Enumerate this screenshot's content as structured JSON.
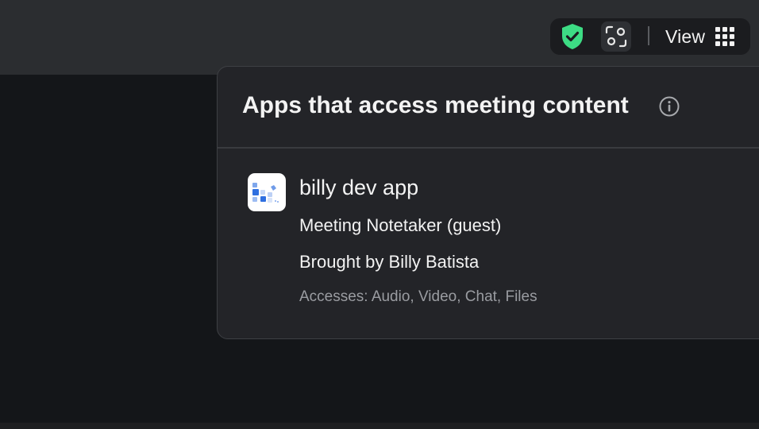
{
  "toolbar": {
    "security_icon": "shield-check-icon",
    "security_color": "#3ddc84",
    "capture_icon": "scan-frame-icon",
    "view_label": "View",
    "view_icon": "grid-icon"
  },
  "popover": {
    "title": "Apps that access meeting content",
    "info_icon": "info-icon",
    "apps": [
      {
        "name": "billy dev app",
        "role": "Meeting Notetaker (guest)",
        "owner": "Brought by Billy Batista",
        "access": "Accesses: Audio, Video, Chat, Files",
        "logo_icon": "app-logo-icon"
      }
    ]
  },
  "colors": {
    "topbar_bg": "#2b2d30",
    "meeting_bg": "#141619",
    "popover_bg": "#232428",
    "muted_text": "#9a9ca1",
    "logo_blue": "#2f6fe0"
  }
}
